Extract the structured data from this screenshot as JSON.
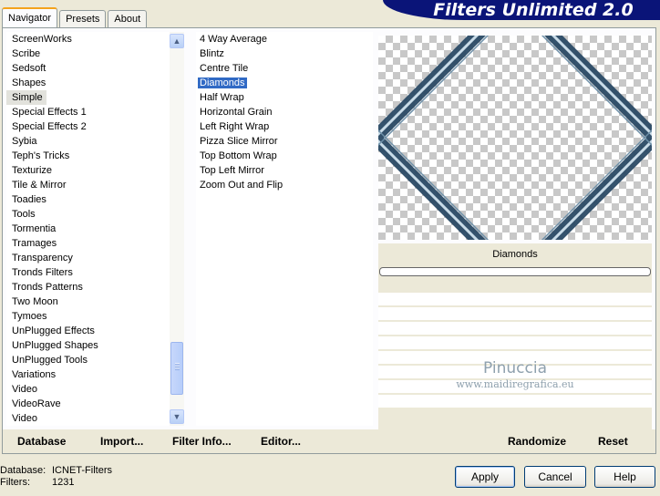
{
  "banner_title": "Filters Unlimited 2.0",
  "tabs": [
    {
      "label": "Navigator",
      "active": true
    },
    {
      "label": "Presets",
      "active": false
    },
    {
      "label": "About",
      "active": false
    }
  ],
  "categories": {
    "items": [
      "ScreenWorks",
      "Scribe",
      "Sedsoft",
      "Shapes",
      "Simple",
      "Special Effects 1",
      "Special Effects 2",
      "Sybia",
      "Teph's Tricks",
      "Texturize",
      "Tile & Mirror",
      "Toadies",
      "Tools",
      "Tormentia",
      "Tramages",
      "Transparency",
      "Tronds Filters",
      "Tronds Patterns",
      "Two Moon",
      "Tymoes",
      "UnPlugged Effects",
      "UnPlugged Shapes",
      "UnPlugged Tools",
      "Variations",
      "Video",
      "VideoRave",
      "Video"
    ],
    "selected": "Simple"
  },
  "filters": {
    "items": [
      "4 Way Average",
      "Blintz",
      "Centre Tile",
      "Diamonds",
      "Half Wrap",
      "Horizontal Grain",
      "Left Right Wrap",
      "Pizza Slice Mirror",
      "Top Bottom Wrap",
      "Top Left Mirror",
      "Zoom Out and Flip"
    ],
    "selected": "Diamonds"
  },
  "preview": {
    "filter_name": "Diamonds",
    "watermark_main": "Pinuccia",
    "watermark_sub": "www.maidiregrafica.eu"
  },
  "bottom_bar": {
    "database": "Database",
    "import": "Import...",
    "filter_info": "Filter Info...",
    "editor": "Editor...",
    "randomize": "Randomize",
    "reset": "Reset"
  },
  "status": {
    "database_label": "Database:",
    "database_value": "ICNET-Filters",
    "filters_label": "Filters:",
    "filters_value": "1231"
  },
  "dialog": {
    "apply": "Apply",
    "cancel": "Cancel",
    "help": "Help"
  },
  "colors": {
    "banner_bg": "#0a1478",
    "selection": "#316ac5",
    "diamond_stroke": "#2b4a66"
  }
}
